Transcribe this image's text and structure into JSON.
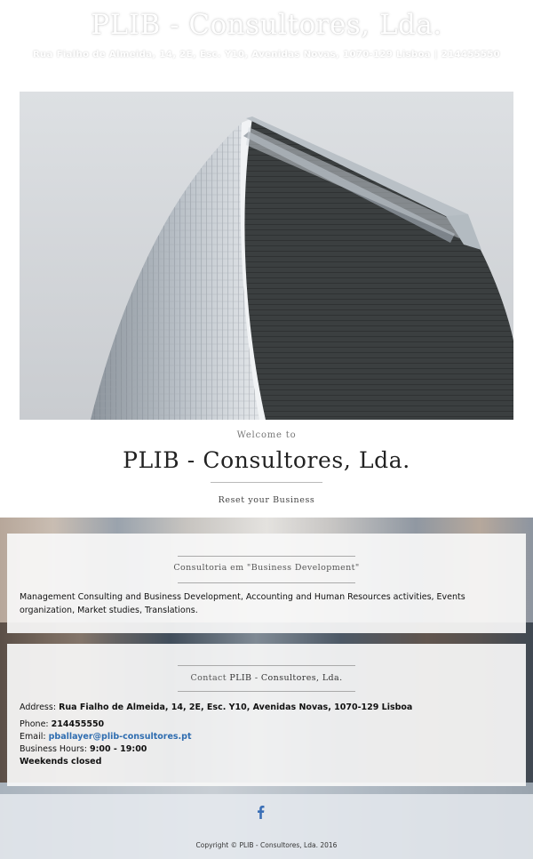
{
  "header": {
    "title": "PLIB - Consultores, Lda.",
    "address": "Rua Fialho de Almeida, 14, 2E, Esc. Y10, Avenidas Novas, 1070-129 Lisboa | 214455550"
  },
  "hero": {
    "welcome": "Welcome to",
    "title": "PLIB - Consultores, Lda.",
    "tagline": "Reset your Business"
  },
  "services": {
    "heading": "Consultoria em \"Business Development\"",
    "body": "Management Consulting and Business Development, Accounting and Human Resources activities, Events organization, Market studies, Translations."
  },
  "contact": {
    "heading_prefix": "Contact",
    "heading_name": "PLIB - Consultores, Lda.",
    "address_label": "Address:",
    "address_value": "Rua Fialho de Almeida, 14, 2E, Esc. Y10, Avenidas Novas, 1070-129 Lisboa",
    "phone_label": "Phone:",
    "phone_value": "214455550",
    "email_label": "Email:",
    "email_value": "pballayer@plib-consultores.pt",
    "hours_label": "Business Hours:",
    "hours_value": "9:00 - 19:00",
    "weekends": "Weekends closed"
  },
  "footer": {
    "social_icon": "facebook-icon",
    "copyright": "Copyright © PLIB - Consultores, Lda. 2016"
  },
  "colors": {
    "link": "#2f6db0",
    "facebook": "#3b6fb6"
  }
}
